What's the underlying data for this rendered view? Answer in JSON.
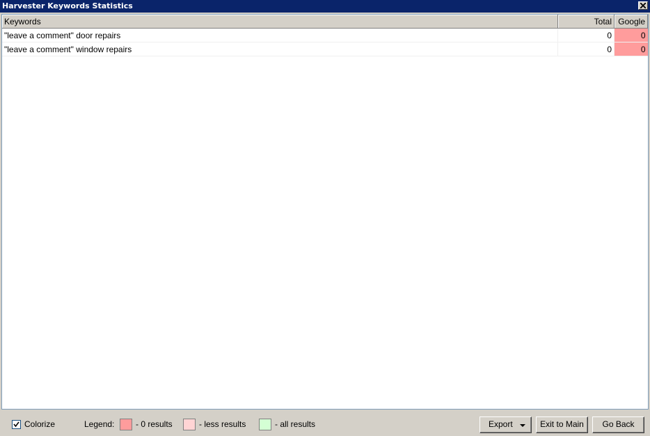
{
  "window": {
    "title": "Harvester Keywords Statistics"
  },
  "table": {
    "headers": {
      "keywords": "Keywords",
      "total": "Total",
      "google": "Google"
    },
    "rows": [
      {
        "keyword": "\"leave a comment\" door repairs",
        "total": "0",
        "google": "0"
      },
      {
        "keyword": "\"leave a comment\" window repairs",
        "total": "0",
        "google": "0"
      }
    ]
  },
  "footer": {
    "colorize_label": "Colorize",
    "colorize_checked": true,
    "legend_label": "Legend:",
    "legend": [
      {
        "label": "- 0 results",
        "color": "#ff9c9c"
      },
      {
        "label": "- less results",
        "color": "#ffd4d4"
      },
      {
        "label": "- all results",
        "color": "#d4ffd4"
      }
    ],
    "export_label": "Export",
    "exit_label": "Exit to Main",
    "goback_label": "Go Back"
  },
  "colors": {
    "titlebar": "#0a246a",
    "zero_cell": "#ff9c9c"
  }
}
